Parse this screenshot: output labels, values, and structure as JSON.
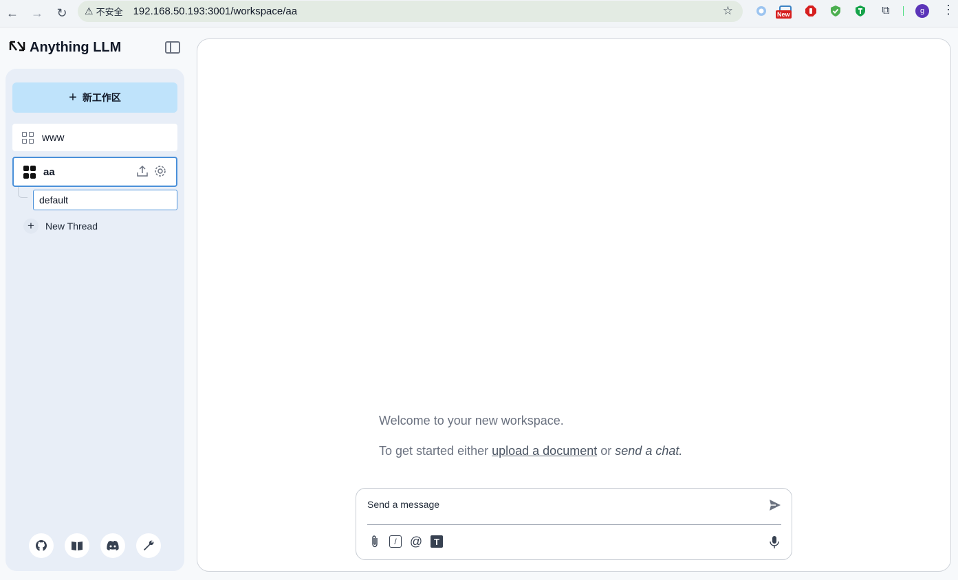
{
  "browser": {
    "insecure_label": "不安全",
    "url": "192.168.50.193:3001/workspace/aa",
    "new_badge": "New",
    "profile_initial": "g"
  },
  "app": {
    "logo_text": "Anything LLM",
    "new_workspace_label": "新工作区",
    "workspaces": [
      {
        "name": "www",
        "active": false
      },
      {
        "name": "aa",
        "active": true
      }
    ],
    "thread": {
      "name": "default"
    },
    "new_thread_label": "New Thread"
  },
  "main": {
    "welcome": "Welcome to your new workspace.",
    "started_prefix": "To get started either",
    "upload_link": "upload a document",
    "or_text": "or",
    "send_chat": "send a chat."
  },
  "composer": {
    "placeholder": "Send a message"
  },
  "colors": {
    "accent": "#4a90d9",
    "new_ws_bg": "#bfe3fb",
    "sidebar_bg": "#e8eef7"
  }
}
